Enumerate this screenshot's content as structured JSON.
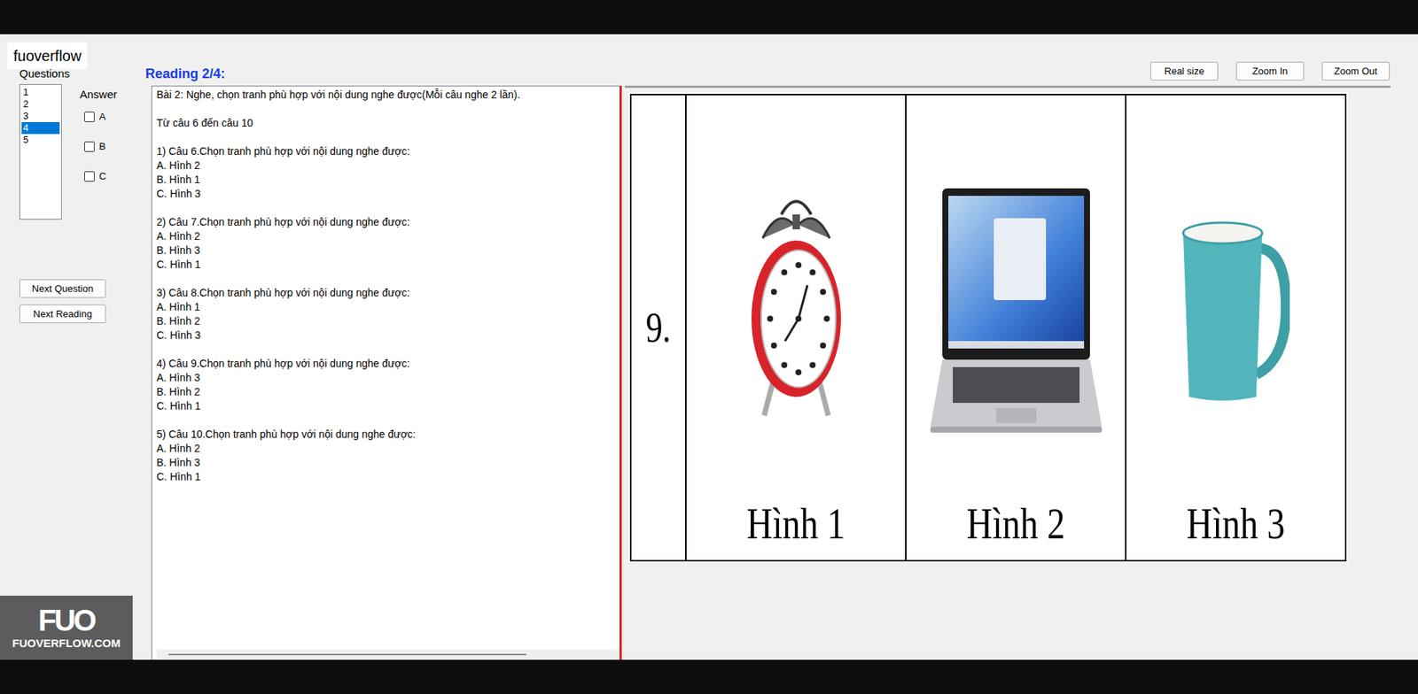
{
  "watermark": "fuoverflow",
  "logo": {
    "mark": "FUO",
    "site": "FUOVERFLOW.COM"
  },
  "sidebar": {
    "questions_label": "Questions",
    "questions": [
      {
        "label": "1",
        "selected": false
      },
      {
        "label": "2",
        "selected": false
      },
      {
        "label": "3",
        "selected": false
      },
      {
        "label": "4",
        "selected": true
      },
      {
        "label": "5",
        "selected": false
      }
    ],
    "answer_label": "Answer",
    "options": [
      {
        "label": "A",
        "checked": false
      },
      {
        "label": "B",
        "checked": false
      },
      {
        "label": "C",
        "checked": false
      }
    ],
    "buttons": [
      "Next Question",
      "Next Reading"
    ]
  },
  "reading": {
    "title": "Reading 2/4:",
    "instruction": "Bài 2: Nghe, chọn tranh phù hợp với nội dung nghe được(Mỗi câu nghe 2 lần).",
    "range": "Từ câu 6 đến câu 10",
    "questions": [
      {
        "prompt": "1) Câu 6.Chọn tranh phù hợp với nội dung nghe được:",
        "choices": [
          "A. Hình 2",
          "B. Hình 1",
          "C. Hình 3"
        ]
      },
      {
        "prompt": "2) Câu 7.Chọn tranh phù hợp với nội dung nghe được:",
        "choices": [
          "A. Hình 2",
          "B. Hình 3",
          "C. Hình 1"
        ]
      },
      {
        "prompt": "3) Câu 8.Chọn tranh phù hợp với nội dung nghe được:",
        "choices": [
          "A. Hình 1",
          "B. Hình 2",
          "C. Hình 3"
        ]
      },
      {
        "prompt": "4) Câu 9.Chọn tranh phù hợp với nội dung nghe được:",
        "choices": [
          "A. Hình 3",
          "B. Hình 2",
          "C. Hình 1"
        ]
      },
      {
        "prompt": "5) Câu 10.Chọn tranh phù hợp với nội dung nghe được:",
        "choices": [
          "A. Hình 2",
          "B. Hình 3",
          "C. Hình 1"
        ]
      }
    ]
  },
  "viewer": {
    "buttons": [
      "Real size",
      "Zoom In",
      "Zoom Out"
    ],
    "figure": {
      "number": "9.",
      "pictures": [
        {
          "kind": "clock",
          "caption": "Hình 1"
        },
        {
          "kind": "laptop",
          "caption": "Hình 2"
        },
        {
          "kind": "mug",
          "caption": "Hình 3"
        }
      ]
    }
  }
}
